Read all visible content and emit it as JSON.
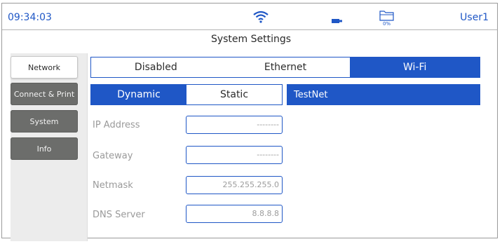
{
  "status_bar": {
    "time": "09:34:03",
    "user": "User1",
    "storage_percent": "0%",
    "icons": [
      "wifi-icon",
      "usb-drive-icon",
      "folder-icon"
    ]
  },
  "page_title": "System Settings",
  "sidebar": {
    "items": [
      {
        "label": "Network",
        "active": true
      },
      {
        "label": "Connect & Print",
        "active": false
      },
      {
        "label": "System",
        "active": false
      },
      {
        "label": "Info",
        "active": false
      }
    ]
  },
  "connection_mode": {
    "options": [
      "Disabled",
      "Ethernet",
      "Wi-Fi"
    ],
    "selected": "Wi-Fi"
  },
  "ip_mode": {
    "options": [
      "Dynamic",
      "Static"
    ],
    "selected": "Dynamic"
  },
  "wifi_network": "TestNet",
  "fields": [
    {
      "label": "IP Address",
      "value": "--------"
    },
    {
      "label": "Gateway",
      "value": "--------"
    },
    {
      "label": "Netmask",
      "value": "255.255.255.0"
    },
    {
      "label": "DNS Server",
      "value": "8.8.8.8"
    }
  ],
  "colors": {
    "accent": "#1f57c6",
    "sidebar_button": "#6c6d6b",
    "label_text": "#9a9a9a"
  }
}
